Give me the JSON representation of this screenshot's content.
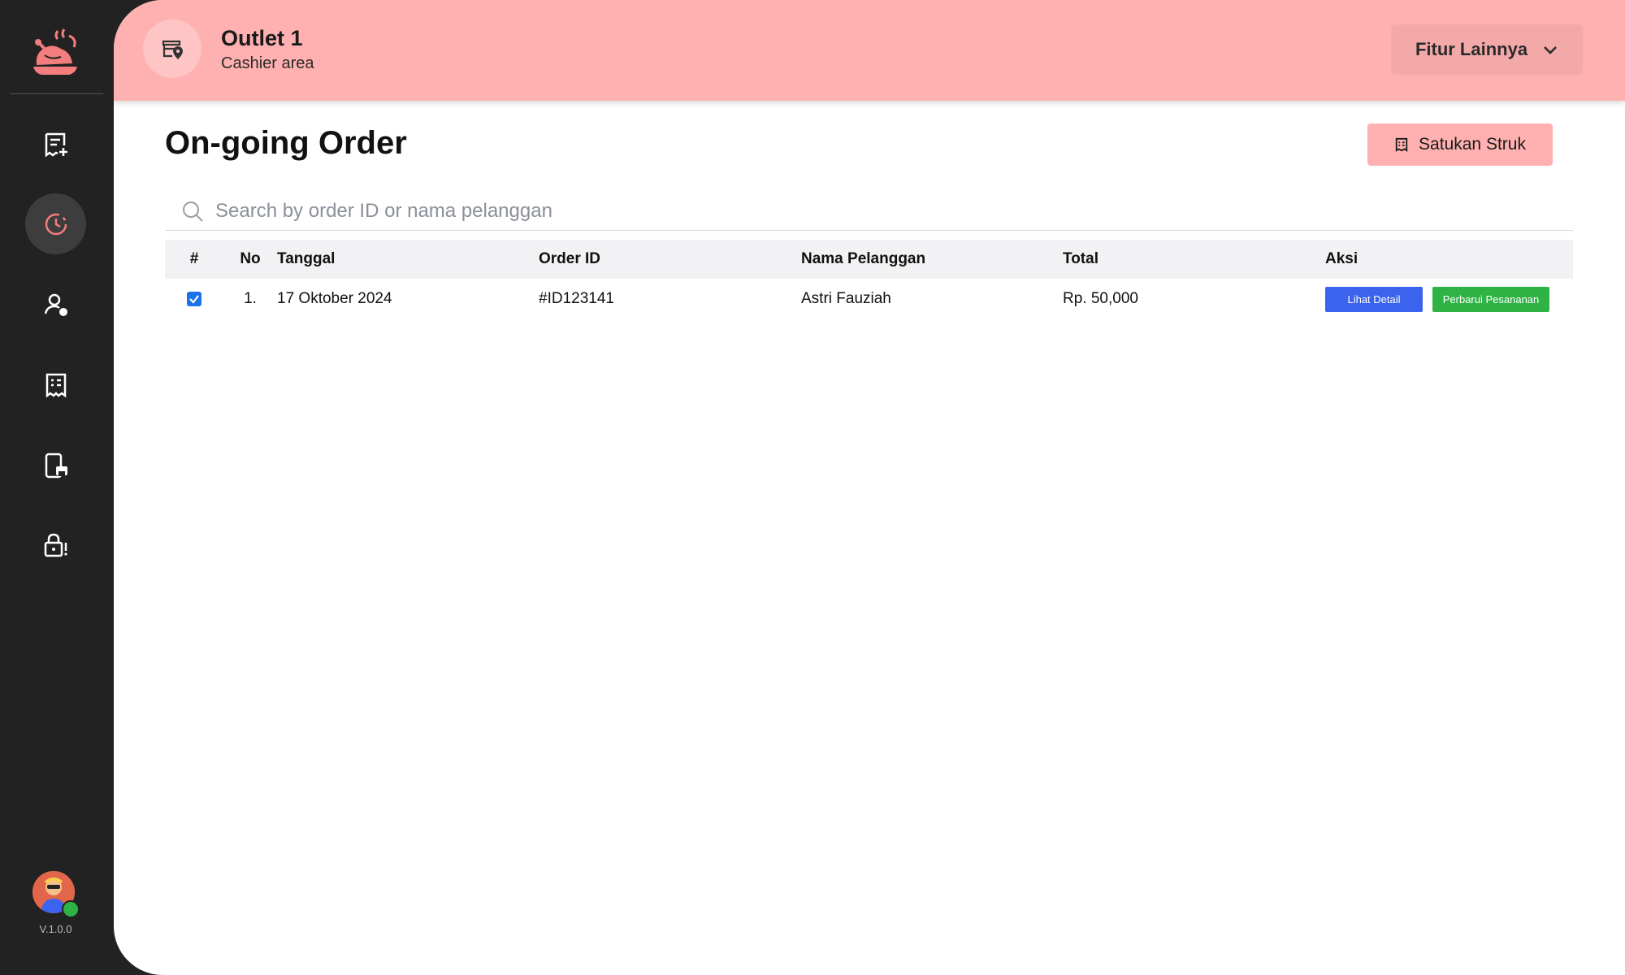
{
  "header": {
    "outlet_name": "Outlet 1",
    "outlet_subtitle": "Cashier area",
    "more_features_label": "Fitur Lainnya"
  },
  "sidebar": {
    "items": [
      {
        "name": "new-order",
        "icon": "receipt-add-icon",
        "active": false
      },
      {
        "name": "ongoing-order",
        "icon": "clock-history-icon",
        "active": true
      },
      {
        "name": "customer",
        "icon": "user-status-icon",
        "active": false
      },
      {
        "name": "receipt",
        "icon": "receipt-icon",
        "active": false
      },
      {
        "name": "printer",
        "icon": "mobile-print-icon",
        "active": false
      },
      {
        "name": "lock",
        "icon": "lock-alert-icon",
        "active": false
      }
    ],
    "version": "V.1.0.0"
  },
  "main": {
    "title": "On-going Order",
    "merge_button_label": "Satukan Struk",
    "search": {
      "placeholder": "Search by order ID or nama pelanggan",
      "value": ""
    },
    "table": {
      "columns": [
        "#",
        "No",
        "Tanggal",
        "Order ID",
        "Nama Pelanggan",
        "Total",
        "Aksi"
      ],
      "rows": [
        {
          "checked": true,
          "no": "1.",
          "date": "17 Oktober 2024",
          "order_id": "#ID123141",
          "customer": "Astri Fauziah",
          "total": "Rp. 50,000",
          "detail_label": "Lihat Detail",
          "update_label": "Perbarui Pesananan"
        }
      ]
    }
  },
  "colors": {
    "sidebar_bg": "#222222",
    "header_bg": "#ffb1b1",
    "accent_pink": "#f47d7d",
    "detail_blue": "#3b63ee",
    "update_green": "#2fb344",
    "online_green": "#2fb344"
  }
}
